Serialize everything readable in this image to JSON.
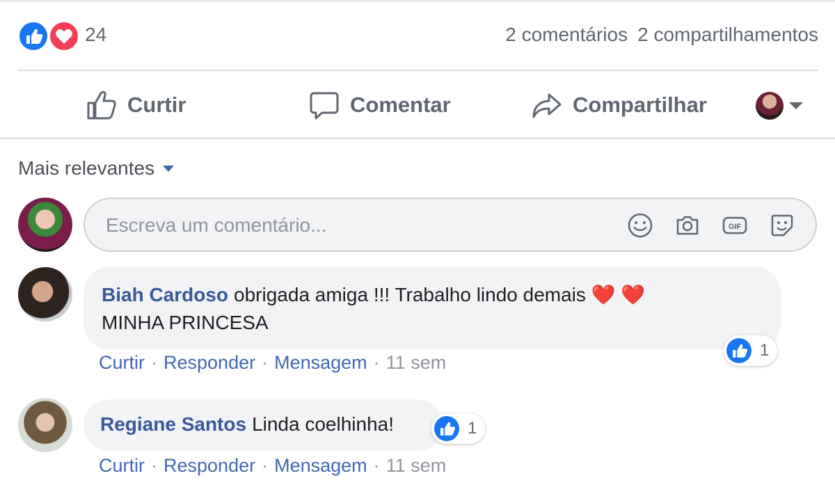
{
  "post": {
    "reaction_count": "24",
    "reaction_types": [
      "like-icon",
      "love-icon"
    ],
    "comments_count": "2 comentários",
    "shares_count": "2 compartilhamentos"
  },
  "actions": {
    "like_label": "Curtir",
    "comment_label": "Comentar",
    "share_label": "Compartilhar"
  },
  "sort": {
    "label": "Mais relevantes"
  },
  "composer": {
    "placeholder": "Escreva um comentário...",
    "icons": [
      "emoji-icon",
      "camera-icon",
      "gif-icon",
      "sticker-icon"
    ]
  },
  "comments": [
    {
      "author": "Biah Cardoso",
      "text": "obrigada amiga !!! Trabalho lindo demais ❤️ ❤️",
      "text_line2": "MINHA PRINCESA",
      "like_count": "1",
      "like_label": "Curtir",
      "reply_label": "Responder",
      "message_label": "Mensagem",
      "time": "11 sem"
    },
    {
      "author": "Regiane Santos",
      "text": "Linda coelhinha!",
      "like_count": "1",
      "like_label": "Curtir",
      "reply_label": "Responder",
      "message_label": "Mensagem",
      "time": "11 sem"
    }
  ],
  "colors": {
    "like_blue": "#1877f2",
    "love_red": "#f33e58",
    "link_blue": "#385898",
    "bubble_bg": "#f2f3f5",
    "muted_text": "#606770"
  }
}
